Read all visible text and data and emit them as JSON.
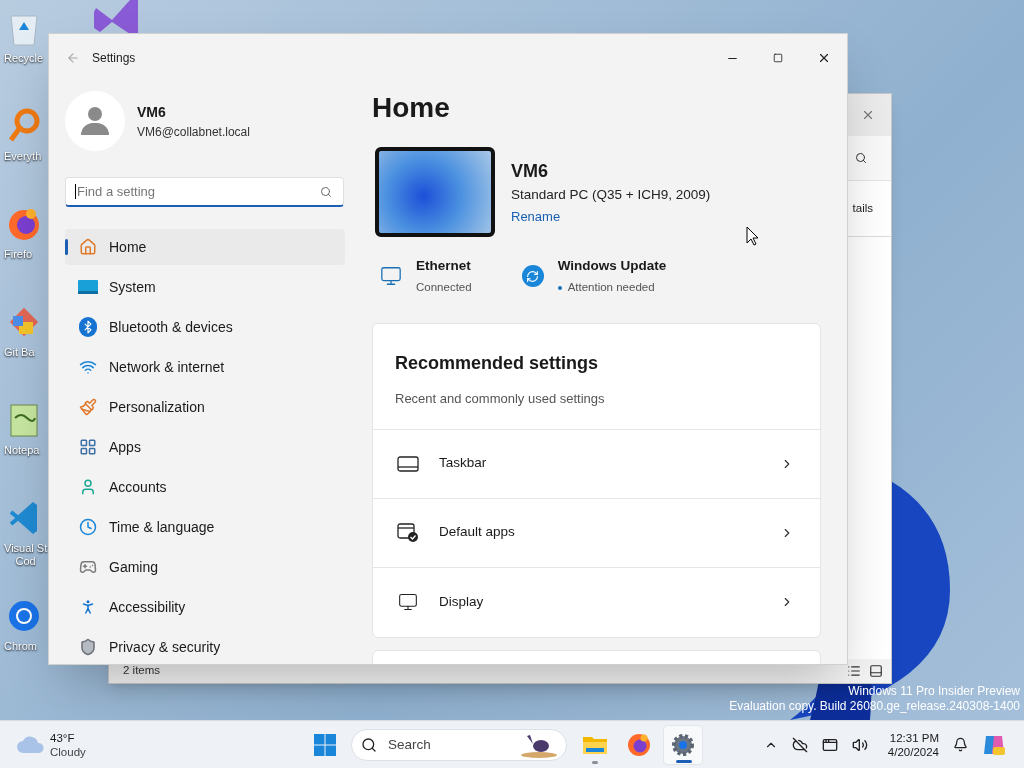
{
  "desktop_icons": [
    {
      "kind": "recycle-bin",
      "label": "Recycle"
    },
    {
      "kind": "search-tool",
      "label": "Everyth"
    },
    {
      "kind": "firefox",
      "label": "Firefo"
    },
    {
      "kind": "git",
      "label": "Git Ba"
    },
    {
      "kind": "notepad",
      "label": "Notepa"
    },
    {
      "kind": "vscode",
      "label": "Visual St\nCod"
    },
    {
      "kind": "chrome",
      "label": "Chrom"
    }
  ],
  "background_window": {
    "tab_fragment": "tails",
    "status": "2 items"
  },
  "settings": {
    "title": "Settings",
    "user": {
      "name": "VM6",
      "email": "VM6@collabnet.local"
    },
    "search": {
      "placeholder": "Find a setting"
    },
    "nav": [
      {
        "kind": "home",
        "label": "Home",
        "selected": true
      },
      {
        "kind": "system",
        "label": "System",
        "selected": false
      },
      {
        "kind": "bluetooth",
        "label": "Bluetooth & devices",
        "selected": false
      },
      {
        "kind": "network",
        "label": "Network & internet",
        "selected": false
      },
      {
        "kind": "brush",
        "label": "Personalization",
        "selected": false
      },
      {
        "kind": "apps",
        "label": "Apps",
        "selected": false
      },
      {
        "kind": "accounts",
        "label": "Accounts",
        "selected": false
      },
      {
        "kind": "time",
        "label": "Time & language",
        "selected": false
      },
      {
        "kind": "gaming",
        "label": "Gaming",
        "selected": false
      },
      {
        "kind": "accessibility",
        "label": "Accessibility",
        "selected": false
      },
      {
        "kind": "privacy",
        "label": "Privacy & security",
        "selected": false
      }
    ],
    "page_title": "Home",
    "device": {
      "name": "VM6",
      "model": "Standard PC (Q35 + ICH9, 2009)",
      "rename": "Rename"
    },
    "status": [
      {
        "kind": "ethernet",
        "title": "Ethernet",
        "detail": "Connected",
        "alert": false
      },
      {
        "kind": "update",
        "title": "Windows Update",
        "detail": "Attention needed",
        "alert": true
      }
    ],
    "recommended": {
      "title": "Recommended settings",
      "subtitle": "Recent and commonly used settings",
      "items": [
        {
          "kind": "taskbar",
          "label": "Taskbar"
        },
        {
          "kind": "default-apps",
          "label": "Default apps"
        },
        {
          "kind": "display",
          "label": "Display"
        }
      ]
    }
  },
  "evaluation_notice": [
    "Windows 11 Pro Insider Preview",
    "Evaluation copy. Build 26080.ge_release.240308-1400"
  ],
  "taskbar": {
    "weather": {
      "temp": "43°F",
      "condition": "Cloudy"
    },
    "search": {
      "placeholder": "Search"
    },
    "apps": [
      {
        "kind": "file-explorer",
        "open": true,
        "selected": false
      },
      {
        "kind": "firefox",
        "open": false,
        "selected": false
      },
      {
        "kind": "settings",
        "open": true,
        "selected": true
      }
    ],
    "time": "12:31 PM",
    "date": "4/20/2024"
  }
}
